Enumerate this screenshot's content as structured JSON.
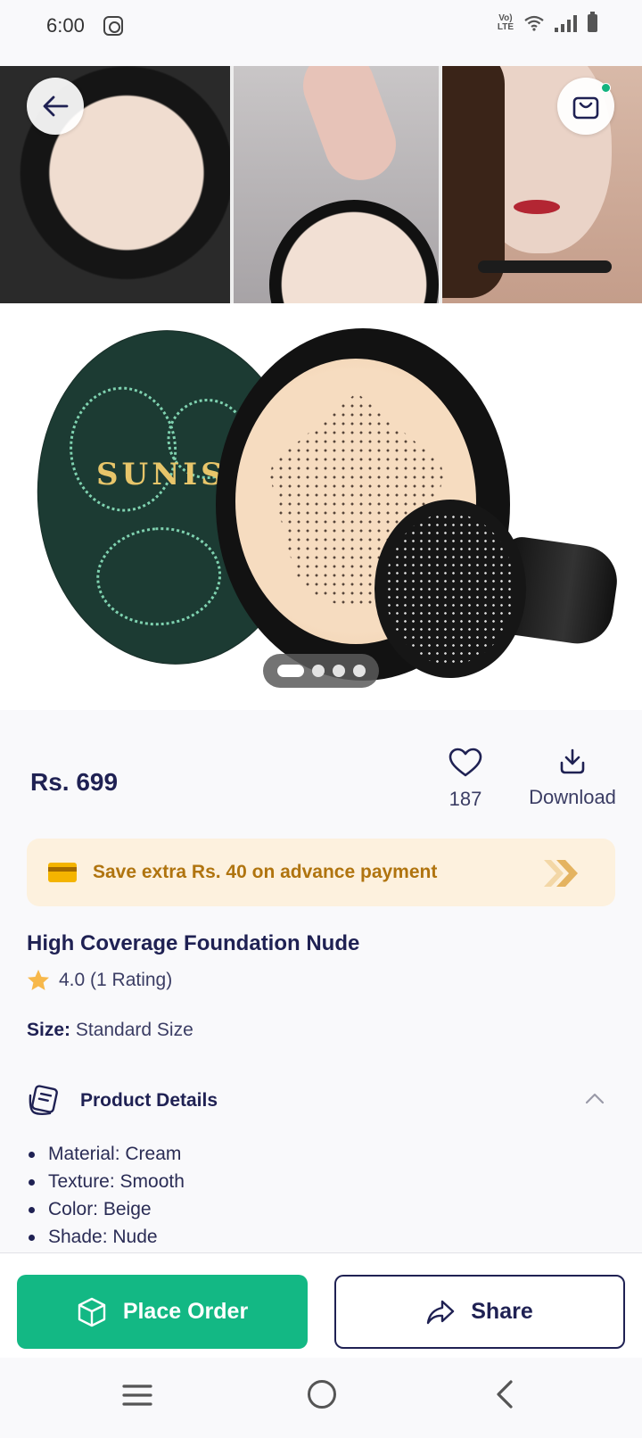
{
  "status_bar": {
    "time": "6:00",
    "network": "Vo)) LTE"
  },
  "header": {
    "back_icon": "arrow-left-icon",
    "cart_icon": "shopping-bag-icon",
    "cart_badge_color": "#13b37f"
  },
  "gallery": {
    "image_count": 4,
    "active_index": 0,
    "lid_brand_text": "SUNIS"
  },
  "product": {
    "price": "Rs. 699",
    "wishlist_count": "187",
    "download_label": "Download",
    "offer_text": "Save extra Rs. 40 on advance payment",
    "title": "High Coverage Foundation Nude",
    "rating_text": "4.0 (1 Rating)",
    "rating_value": 4.0,
    "size_label": "Size:",
    "size_value": "Standard Size"
  },
  "details": {
    "title": "Product Details",
    "expanded": true,
    "items": [
      "Material: Cream",
      "Texture: Smooth",
      "Color: Beige",
      "Shade: Nude"
    ]
  },
  "actions": {
    "place_order_label": "Place Order",
    "share_label": "Share"
  },
  "colors": {
    "primary_text": "#1f2153",
    "accent_green": "#13b884",
    "offer_bg": "#fdf1de",
    "offer_text": "#b0740f"
  }
}
